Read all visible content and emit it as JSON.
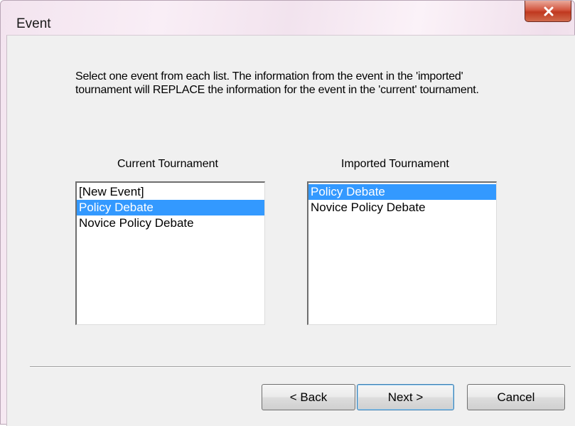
{
  "window": {
    "title": "Event"
  },
  "instructions": "Select one event from each list.  The information from the event in the 'imported' tournament will REPLACE the information for the event in the 'current' tournament.",
  "current_list": {
    "label": "Current Tournament",
    "items": [
      "[New Event]",
      "Policy Debate",
      "Novice Policy Debate"
    ],
    "selected": "Policy Debate"
  },
  "imported_list": {
    "label": "Imported Tournament",
    "items": [
      "Policy Debate",
      "Novice Policy Debate"
    ],
    "selected": "Policy Debate"
  },
  "buttons": {
    "back": "< Back",
    "next": "Next >",
    "cancel": "Cancel"
  },
  "icons": {
    "close": "close-icon"
  },
  "colors": {
    "selection": "#3399ff",
    "close_button": "#c7432a"
  }
}
